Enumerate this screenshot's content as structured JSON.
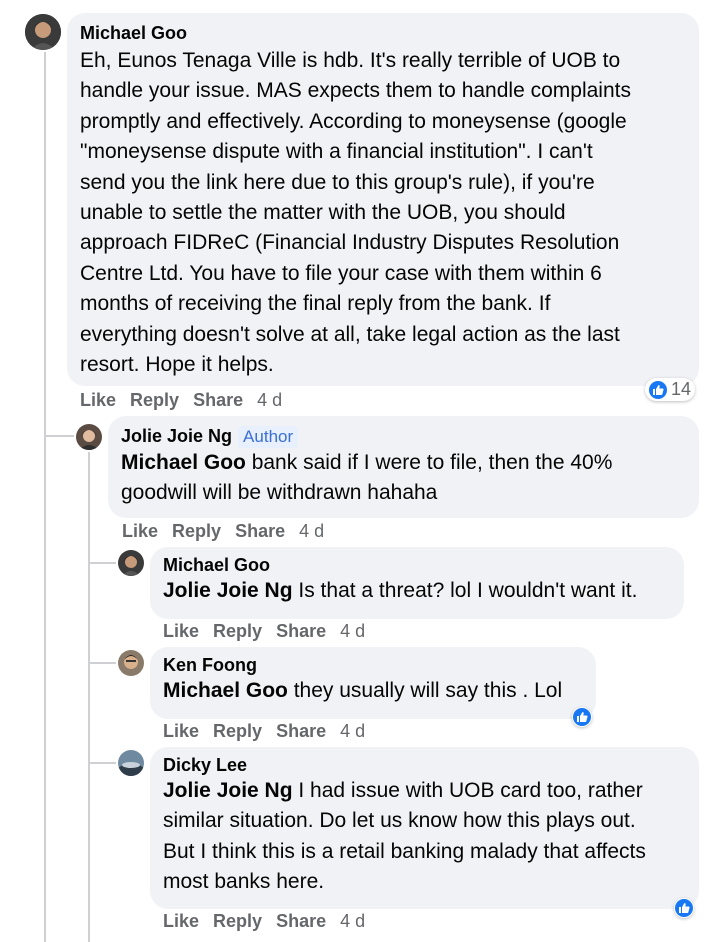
{
  "colors": {
    "bubble": "#f0f2f5",
    "action_text": "#65676b",
    "like_blue": "#1877f2",
    "author_badge_bg": "#e7f0fc",
    "author_badge_text": "#3b6fd4"
  },
  "actions": {
    "like": "Like",
    "reply": "Reply",
    "share": "Share"
  },
  "comments": [
    {
      "name": "Michael Goo",
      "mention": "",
      "lines": [
        "Eh, Eunos Tenaga Ville is hdb. It's really terrible of UOB to",
        "handle your issue. MAS expects them to handle complaints",
        "promptly and effectively. According to moneysense (google",
        "\"moneysense dispute with a financial institution\". I can't",
        "send you the link here due to this group's rule), if you're",
        "unable to settle the matter with the UOB, you should",
        "approach FIDReC (Financial Industry Disputes Resolution",
        "Centre Ltd. You have to file your case with them within 6",
        "months of receiving the final reply from the bank. If",
        "everything doesn't solve at all, take legal action as the last",
        "resort. Hope it helps."
      ],
      "time": "4 d",
      "reaction_count": "14",
      "reaction_icon": "like-icon"
    },
    {
      "name": "Jolie Joie Ng",
      "badge": "Author",
      "mention": "Michael Goo",
      "lines_first_rest": " bank said if I were to file, then the 40%",
      "lines": [
        "goodwill will be withdrawn hahaha"
      ],
      "time": "4 d"
    },
    {
      "name": "Michael Goo",
      "mention": "Jolie Joie Ng",
      "lines_first_rest": " Is that a threat? lol I wouldn't want it.",
      "time": "4 d"
    },
    {
      "name": "Ken Foong",
      "mention": "Michael Goo",
      "lines_first_rest": " they usually will say this . Lol",
      "time": "4 d",
      "reaction_icon": "like-icon"
    },
    {
      "name": "Dicky Lee",
      "mention": "Jolie Joie Ng",
      "lines_first_rest": " I had issue with UOB card too, rather",
      "lines": [
        "similar situation. Do let us know how this plays out.",
        "But I think this is a retail banking malady that affects",
        "most banks here."
      ],
      "time": "4 d",
      "reaction_icon": "like-icon"
    }
  ]
}
